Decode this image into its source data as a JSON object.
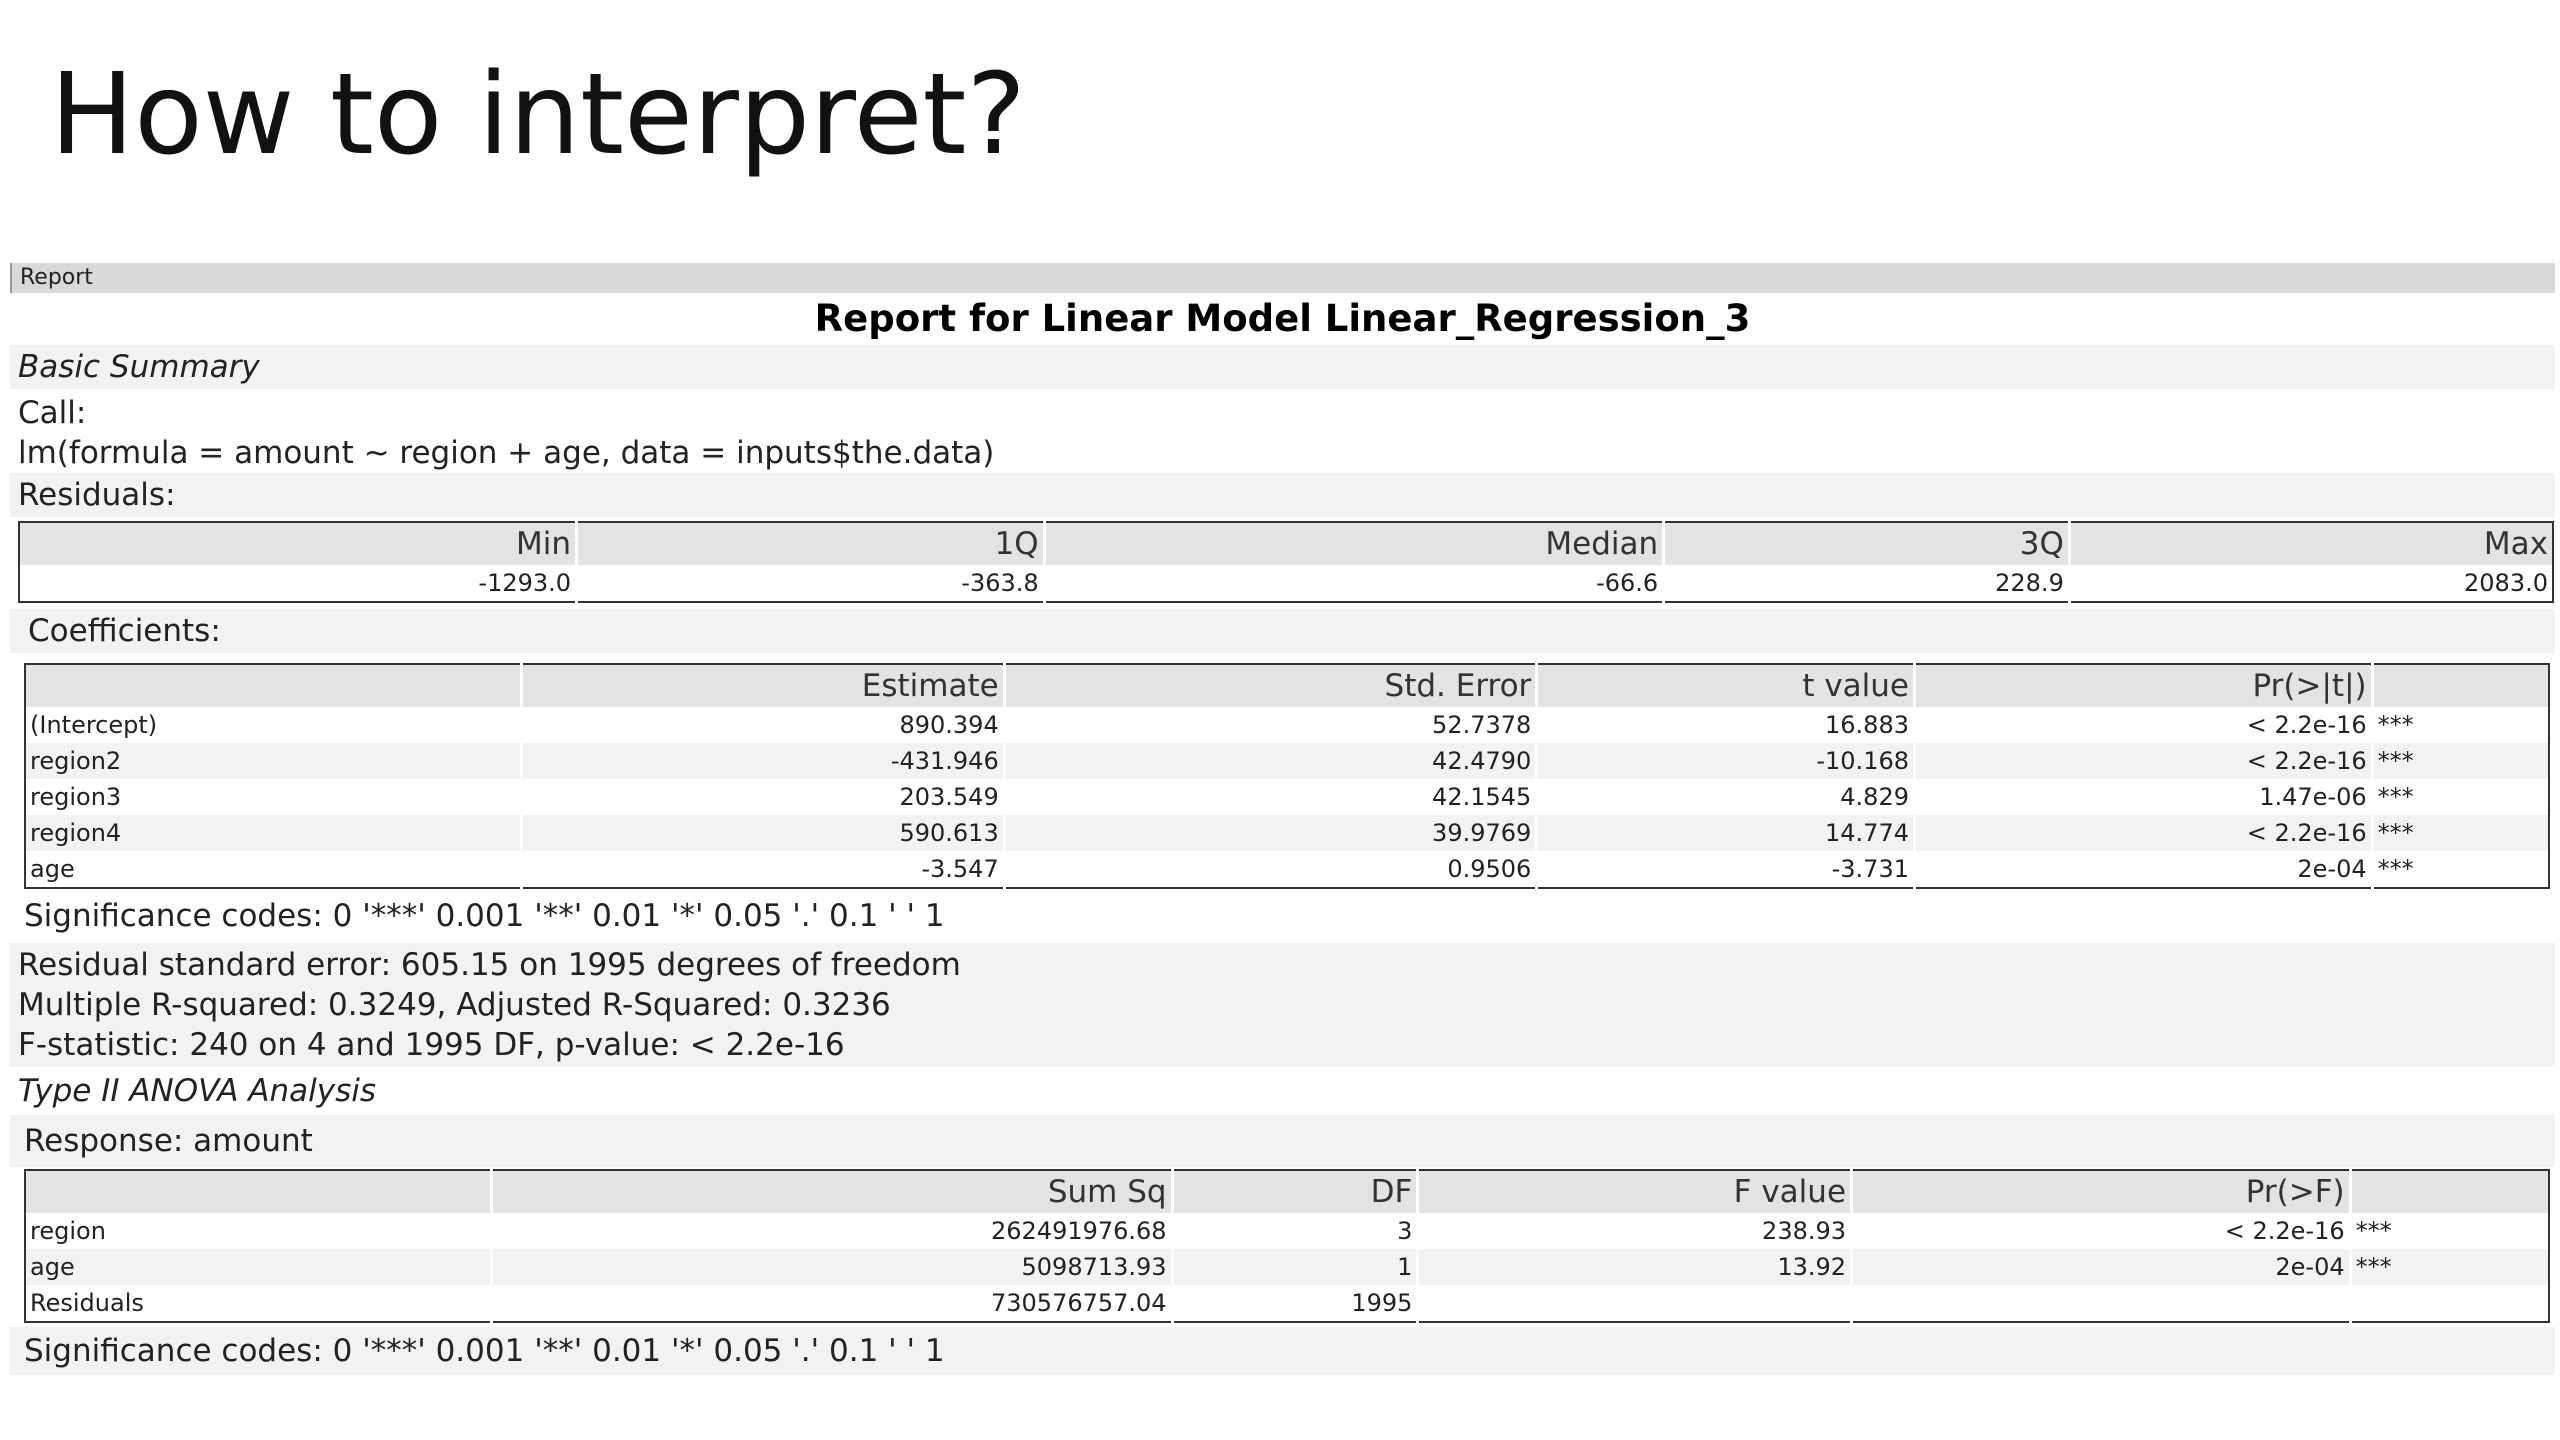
{
  "slide": {
    "title": "How to interpret?"
  },
  "report": {
    "header_label": "Report",
    "title": "Report for Linear Model Linear_Regression_3",
    "basic_summary_heading": "Basic Summary",
    "call_label": "Call:",
    "call_formula": "lm(formula = amount ~ region + age, data = inputs$the.data)",
    "residuals_label": "Residuals:",
    "residuals": {
      "headers": [
        "Min",
        "1Q",
        "Median",
        "3Q",
        "Max"
      ],
      "values": [
        "-1293.0",
        "-363.8",
        "-66.6",
        "228.9",
        "2083.0"
      ]
    },
    "coefficients_label": "Coefficients:",
    "coefficients": {
      "headers": [
        "",
        "Estimate",
        "Std. Error",
        "t value",
        "Pr(>|t|)",
        ""
      ],
      "rows": [
        [
          "(Intercept)",
          "890.394",
          "52.7378",
          "16.883",
          "< 2.2e-16",
          "***"
        ],
        [
          "region2",
          "-431.946",
          "42.4790",
          "-10.168",
          "< 2.2e-16",
          "***"
        ],
        [
          "region3",
          "203.549",
          "42.1545",
          "4.829",
          "1.47e-06",
          "***"
        ],
        [
          "region4",
          "590.613",
          "39.9769",
          "14.774",
          "< 2.2e-16",
          "***"
        ],
        [
          "age",
          "-3.547",
          "0.9506",
          "-3.731",
          "2e-04",
          "***"
        ]
      ]
    },
    "significance_codes": "Significance codes: 0 '***' 0.001 '**' 0.01 '*' 0.05 '.' 0.1 ' ' 1",
    "model_stats": [
      "Residual standard error: 605.15 on 1995 degrees of freedom",
      "Multiple R-squared: 0.3249, Adjusted R-Squared: 0.3236",
      "F-statistic: 240 on 4 and 1995 DF, p-value: < 2.2e-16"
    ],
    "anova_heading": "Type II ANOVA Analysis",
    "response_label": "Response: amount",
    "anova": {
      "headers": [
        "",
        "Sum Sq",
        "DF",
        "F value",
        "Pr(>F)",
        ""
      ],
      "rows": [
        [
          "region",
          "262491976.68",
          "3",
          "238.93",
          "< 2.2e-16",
          "***"
        ],
        [
          "age",
          "5098713.93",
          "1",
          "13.92",
          "2e-04",
          "***"
        ],
        [
          "Residuals",
          "730576757.04",
          "1995",
          "",
          "",
          ""
        ]
      ]
    },
    "anova_significance_codes": "Significance codes: 0 '***' 0.001 '**' 0.01 '*' 0.05 '.' 0.1 ' ' 1"
  }
}
